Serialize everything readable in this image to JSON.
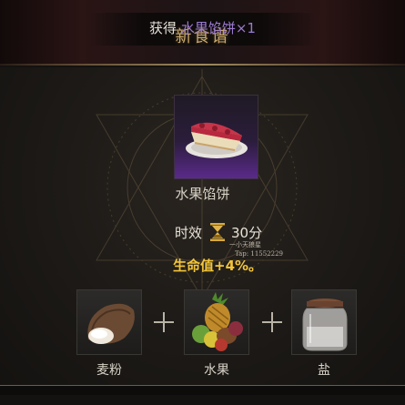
{
  "header": {
    "title": "新食谱",
    "obtained_prefix": "获得",
    "obtained_item": "水果馅饼×1"
  },
  "recipe": {
    "item_name": "水果馅饼",
    "item_icon": "fruit-pie-icon",
    "duration_label": "时效",
    "duration_value": "30分",
    "effect": "生命值+4%。"
  },
  "watermark": {
    "line1": "一小天狼星",
    "line2": "Tap: 11552229"
  },
  "ingredients": [
    {
      "label": "麦粉",
      "icon": "flour-sack-icon"
    },
    {
      "label": "水果",
      "icon": "fruit-pile-icon"
    },
    {
      "label": "盐",
      "icon": "salt-jar-icon"
    }
  ],
  "colors": {
    "accent_gold": "#c9a86a",
    "effect_yellow": "#f3c53a",
    "item_purple": "#9b7ad0",
    "rarity_gradient": "#5a2a8a"
  }
}
